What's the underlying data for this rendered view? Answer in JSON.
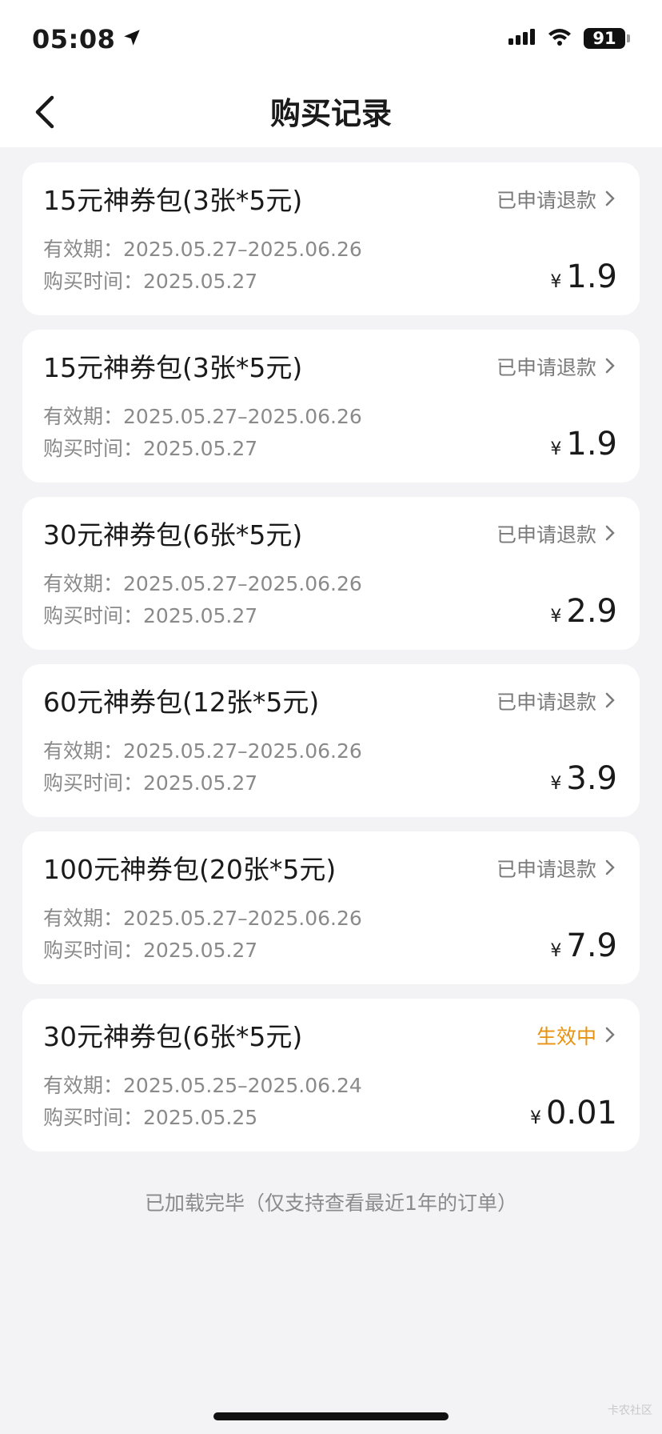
{
  "status_bar": {
    "time": "05:08",
    "battery": "91",
    "icons": [
      "location-arrow-icon",
      "cellular-signal-icon",
      "wifi-icon",
      "battery-icon"
    ]
  },
  "nav": {
    "title": "购买记录",
    "back_icon": "chevron-left-icon"
  },
  "labels": {
    "validity_prefix": "有效期：",
    "purchase_prefix": "购买时间：",
    "currency": "¥"
  },
  "orders": [
    {
      "title": "15元神券包(3张*5元)",
      "status": "已申请退款",
      "validity": "2025.05.27–2025.06.26",
      "purchase_time": "2025.05.27",
      "price": "1.9"
    },
    {
      "title": "15元神券包(3张*5元)",
      "status": "已申请退款",
      "validity": "2025.05.27–2025.06.26",
      "purchase_time": "2025.05.27",
      "price": "1.9"
    },
    {
      "title": "30元神券包(6张*5元)",
      "status": "已申请退款",
      "validity": "2025.05.27–2025.06.26",
      "purchase_time": "2025.05.27",
      "price": "2.9"
    },
    {
      "title": "60元神券包(12张*5元)",
      "status": "已申请退款",
      "validity": "2025.05.27–2025.06.26",
      "purchase_time": "2025.05.27",
      "price": "3.9"
    },
    {
      "title": "100元神券包(20张*5元)",
      "status": "已申请退款",
      "validity": "2025.05.27–2025.06.26",
      "purchase_time": "2025.05.27",
      "price": "7.9"
    },
    {
      "title": "30元神券包(6张*5元)",
      "status": "生效中",
      "validity": "2025.05.25–2025.06.24",
      "purchase_time": "2025.05.25",
      "price": "0.01"
    }
  ],
  "colors": {
    "active_status": "#e8920f",
    "muted_text": "#8a8a8a",
    "background": "#f3f3f5"
  },
  "footer": {
    "note": "已加载完毕（仅支持查看最近1年的订单）"
  },
  "watermark": "卡农社区"
}
